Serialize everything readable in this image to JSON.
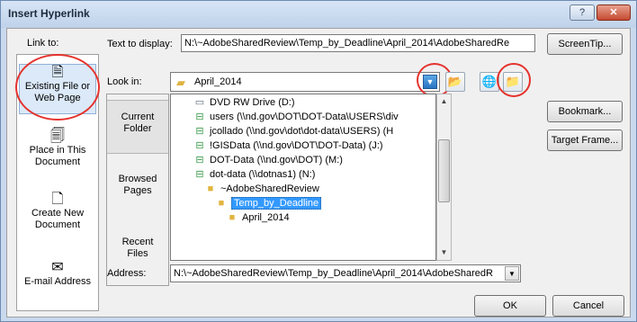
{
  "window": {
    "title": "Insert Hyperlink",
    "help_glyph": "?",
    "close_glyph": "✕"
  },
  "link_to": {
    "label": "Link to:",
    "items": [
      {
        "line1": "Existing File or",
        "line2": "Web Page",
        "icon": "file-globe-icon",
        "selected": true
      },
      {
        "line1": "Place in This",
        "line2": "Document",
        "icon": "document-place-icon",
        "selected": false
      },
      {
        "line1": "Create New",
        "line2": "Document",
        "icon": "new-document-icon",
        "selected": false
      },
      {
        "line1": "E-mail Address",
        "line2": "",
        "icon": "email-icon",
        "selected": false
      }
    ]
  },
  "text_to_display": {
    "label": "Text to display:",
    "value": "N:\\~AdobeSharedReview\\Temp_by_Deadline\\April_2014\\AdobeSharedRe"
  },
  "look_in": {
    "label": "Look in:",
    "value": "April_2014"
  },
  "side_tabs": [
    {
      "line1": "Current",
      "line2": "Folder"
    },
    {
      "line1": "Browsed",
      "line2": "Pages"
    },
    {
      "line1": "Recent",
      "line2": "Files"
    }
  ],
  "folder_list": [
    {
      "text": "DVD RW Drive (D:)",
      "icon": "drive-icon",
      "indent": 0
    },
    {
      "text": "users (\\\\nd.gov\\DOT\\DOT-Data\\USERS\\div",
      "icon": "network-drive-icon",
      "indent": 0
    },
    {
      "text": "jcollado (\\\\nd.gov\\dot\\dot-data\\USERS) (H",
      "icon": "network-drive-icon",
      "indent": 0
    },
    {
      "text": "!GISData (\\\\nd.gov\\DOT\\DOT-Data) (J:)",
      "icon": "network-drive-icon",
      "indent": 0
    },
    {
      "text": "DOT-Data (\\\\nd.gov\\DOT) (M:)",
      "icon": "network-drive-icon",
      "indent": 0
    },
    {
      "text": "dot-data (\\\\dotnas1) (N:)",
      "icon": "network-drive-icon",
      "indent": 0
    },
    {
      "text": "~AdobeSharedReview",
      "icon": "folder-icon",
      "indent": 1
    },
    {
      "text": "Temp_by_Deadline",
      "icon": "folder-open-icon",
      "indent": 2,
      "selected": true
    },
    {
      "text": "April_2014",
      "icon": "folder-open-icon",
      "indent": 3
    }
  ],
  "address": {
    "label": "Address:",
    "value": "N:\\~AdobeSharedReview\\Temp_by_Deadline\\April_2014\\AdobeSharedR"
  },
  "buttons": {
    "screentip": "ScreenTip...",
    "bookmark": "Bookmark...",
    "target_frame": "Target Frame...",
    "ok": "OK",
    "cancel": "Cancel"
  },
  "colors": {
    "highlight_circle": "#e5322d",
    "selection_blue": "#3399ff"
  }
}
